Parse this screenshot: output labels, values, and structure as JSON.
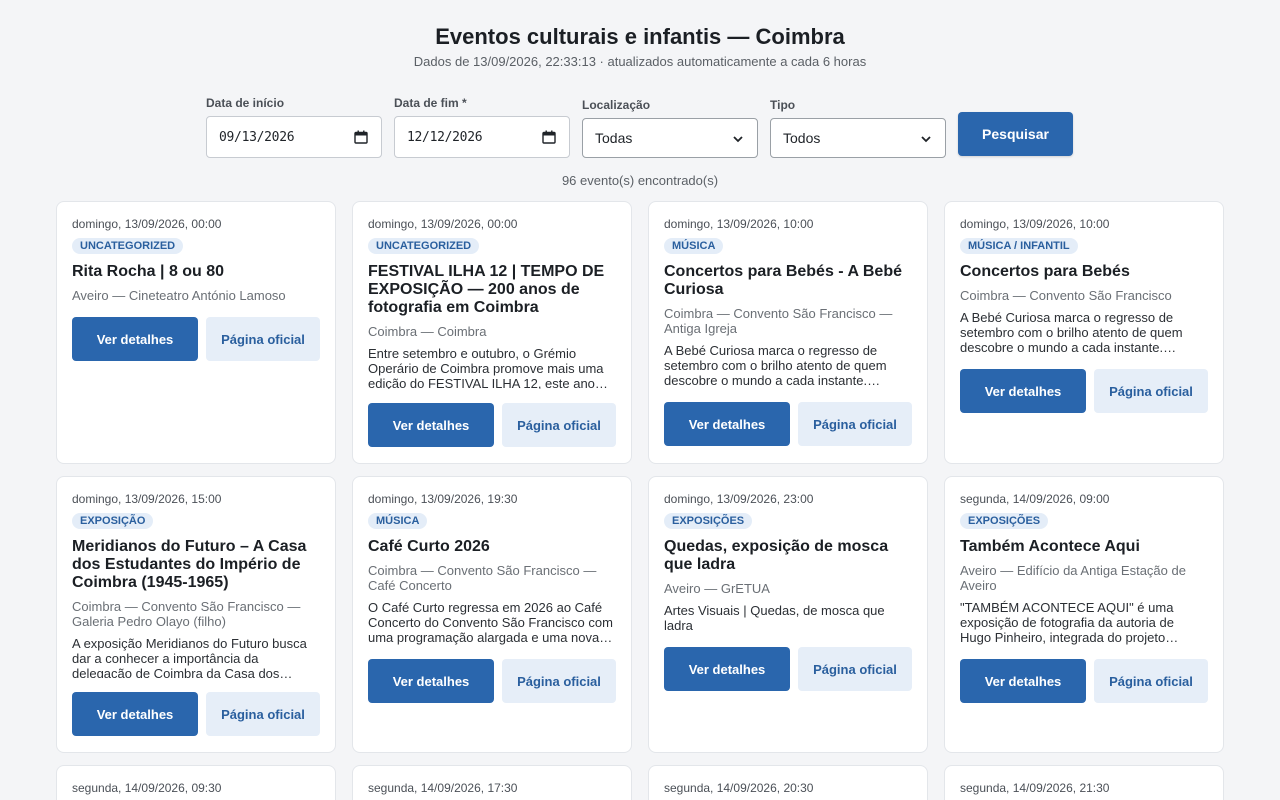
{
  "header": {
    "title": "Eventos culturais e infantis — Coimbra",
    "subtitle": "Dados de 13/09/2026, 22:33:13 · atualizados automaticamente a cada 6 horas"
  },
  "filters": {
    "start_label": "Data de início",
    "start_value": "09/13/2026",
    "end_label": "Data de fim *",
    "end_value": "12/12/2026",
    "location_label": "Localização",
    "location_value": "Todas",
    "type_label": "Tipo",
    "type_value": "Todos",
    "search_label": "Pesquisar"
  },
  "results_count": "96 evento(s) encontrado(s)",
  "buttons": {
    "details": "Ver detalhes",
    "official": "Página oficial"
  },
  "events": [
    {
      "date": "domingo, 13/09/2026, 00:00",
      "category": "UNCATEGORIZED",
      "title": "Rita Rocha | 8 ou 80",
      "location": "Aveiro — Cineteatro António Lamoso",
      "description": ""
    },
    {
      "date": "domingo, 13/09/2026, 00:00",
      "category": "UNCATEGORIZED",
      "title": "FESTIVAL ILHA 12 | TEMPO DE EXPOSIÇÃO — 200 anos de fotografia em Coimbra",
      "location": "Coimbra — Coimbra",
      "description": "Entre setembro e outubro, o Grémio Operário de Coimbra promove mais uma edição do FESTIVAL ILHA 12, este ano…"
    },
    {
      "date": "domingo, 13/09/2026, 10:00",
      "category": "MÚSICA",
      "title": "Concertos para Bebés - A Bebé Curiosa",
      "location": "Coimbra — Convento São Francisco — Antiga Igreja",
      "description": "A Bebé Curiosa marca o regresso de setembro com o brilho atento de quem descobre o mundo a cada instante.…"
    },
    {
      "date": "domingo, 13/09/2026, 10:00",
      "category": "MÚSICA / INFANTIL",
      "title": "Concertos para Bebés",
      "location": "Coimbra — Convento São Francisco",
      "description": "A Bebé Curiosa marca o regresso de setembro com o brilho atento de quem descobre o mundo a cada instante.…"
    },
    {
      "date": "domingo, 13/09/2026, 15:00",
      "category": "EXPOSIÇÃO",
      "title": "Meridianos do Futuro – A Casa dos Estudantes do Império de Coimbra (1945-1965)",
      "location": "Coimbra — Convento São Francisco — Galeria Pedro Olayo (filho)",
      "description": "A exposição Meridianos do Futuro busca dar a conhecer a importância da delegação de Coimbra da Casa dos…"
    },
    {
      "date": "domingo, 13/09/2026, 19:30",
      "category": "MÚSICA",
      "title": "Café Curto 2026",
      "location": "Coimbra — Convento São Francisco — Café Concerto",
      "description": "O Café Curto regressa em 2026 ao Café Concerto do Convento São Francisco com uma programação alargada e uma nova…"
    },
    {
      "date": "domingo, 13/09/2026, 23:00",
      "category": "EXPOSIÇÕES",
      "title": "Quedas, exposição de mosca que ladra",
      "location": "Aveiro — GrETUA",
      "description": "Artes Visuais | Quedas, de mosca que ladra"
    },
    {
      "date": "segunda, 14/09/2026, 09:00",
      "category": "EXPOSIÇÕES",
      "title": "Também Acontece Aqui",
      "location": "Aveiro — Edifício da Antiga Estação de Aveiro",
      "description": "\"TAMBÉM ACONTECE AQUI\" é uma exposição de fotografia da autoria de Hugo Pinheiro, integrada do projeto…"
    }
  ],
  "next_row_dates": [
    "segunda, 14/09/2026, 09:30",
    "segunda, 14/09/2026, 17:30",
    "segunda, 14/09/2026, 20:30",
    "segunda, 14/09/2026, 21:30"
  ]
}
